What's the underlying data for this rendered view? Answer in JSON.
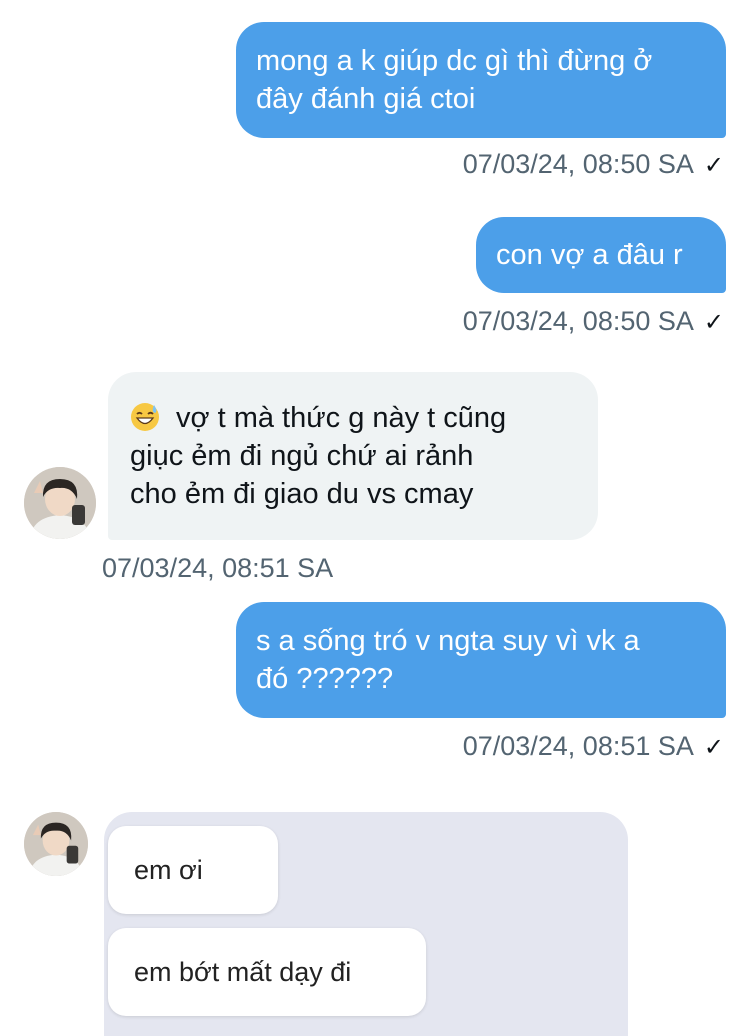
{
  "messages": [
    {
      "id": "m1",
      "direction": "outgoing",
      "lines": [
        "mong a k giúp dc gì thì đừng ở",
        "đây đánh giá ctoi"
      ],
      "timestamp": "07/03/24, 08:50 SA",
      "status": "✓"
    },
    {
      "id": "m2",
      "direction": "outgoing",
      "lines": [
        "con vợ a đâu r"
      ],
      "timestamp": "07/03/24, 08:50 SA",
      "status": "✓"
    },
    {
      "id": "m3",
      "direction": "incoming",
      "emoji": "grinning-sweat-emoji",
      "lines": [
        "vợ t mà thức g này t cũng",
        "giục ẻm đi ngủ chứ ai rảnh",
        "cho ẻm đi giao du vs cmay"
      ],
      "timestamp": "07/03/24, 08:51 SA"
    },
    {
      "id": "m4",
      "direction": "outgoing",
      "lines": [
        "s a sống tró v ngta suy vì vk a",
        "đó ??????"
      ],
      "timestamp": "07/03/24, 08:51 SA",
      "status": "✓"
    }
  ],
  "media": {
    "bubbles": [
      "em ơi",
      "em bớt mất dạy đi"
    ]
  },
  "colors": {
    "outgoing_bubble": "#4c9fe9",
    "incoming_bubble": "#eff3f4",
    "timestamp": "#536471",
    "media_background": "#e4e6f0"
  }
}
